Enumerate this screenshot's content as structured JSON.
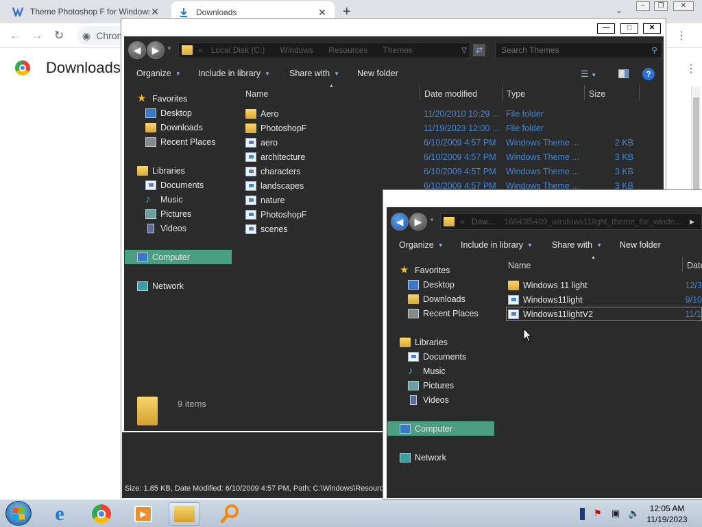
{
  "browser": {
    "tabs": [
      {
        "title": "Theme Photoshop F for Windows"
      },
      {
        "title": "Downloads"
      }
    ],
    "new_tab": "+",
    "omnibox_text": "Chrom",
    "page_title": "Downloads"
  },
  "explorer1": {
    "breadcrumb": [
      "Local Disk (C:)",
      "Windows",
      "Resources",
      "Themes"
    ],
    "search_placeholder": "Search Themes",
    "toolbar": {
      "organize": "Organize",
      "include": "Include in library",
      "share": "Share with",
      "new_folder": "New folder"
    },
    "columns": {
      "name": "Name",
      "date": "Date modified",
      "type": "Type",
      "size": "Size"
    },
    "files": [
      {
        "name": "Aero",
        "date": "11/20/2010 10:29 ...",
        "type": "File folder",
        "size": "",
        "icon": "folder-icon"
      },
      {
        "name": "PhotoshopF",
        "date": "11/19/2023 12:00 ...",
        "type": "File folder",
        "size": "",
        "icon": "folder-icon"
      },
      {
        "name": "aero",
        "date": "6/10/2009 4:57 PM",
        "type": "Windows Theme ...",
        "size": "2 KB",
        "icon": "theme-file-icon"
      },
      {
        "name": "architecture",
        "date": "6/10/2009 4:57 PM",
        "type": "Windows Theme ...",
        "size": "3 KB",
        "icon": "theme-file-icon"
      },
      {
        "name": "characters",
        "date": "6/10/2009 4:57 PM",
        "type": "Windows Theme ...",
        "size": "3 KB",
        "icon": "theme-file-icon"
      },
      {
        "name": "landscapes",
        "date": "6/10/2009 4:57 PM",
        "type": "Windows Theme ...",
        "size": "3 KB",
        "icon": "theme-file-icon"
      },
      {
        "name": "nature",
        "date": "",
        "type": "",
        "size": "",
        "icon": "theme-file-icon"
      },
      {
        "name": "PhotoshopF",
        "date": "",
        "type": "",
        "size": "",
        "icon": "theme-file-icon"
      },
      {
        "name": "scenes",
        "date": "",
        "type": "",
        "size": "",
        "icon": "theme-file-icon"
      }
    ],
    "status_count": "9 items",
    "details_bar": "Size: 1.85 KB, Date Modified: 6/10/2009 4:57 PM, Path: C:\\Windows\\Resource"
  },
  "nav": {
    "favorites": "Favorites",
    "desktop": "Desktop",
    "downloads": "Downloads",
    "recent": "Recent Places",
    "libraries": "Libraries",
    "documents": "Documents",
    "music": "Music",
    "pictures": "Pictures",
    "videos": "Videos",
    "computer": "Computer",
    "network": "Network"
  },
  "explorer2": {
    "breadcrumb": [
      "Dow...",
      "16843f5409_windows11light_theme_for_windo..."
    ],
    "toolbar": {
      "organize": "Organize",
      "include": "Include in library",
      "share": "Share with",
      "new_folder": "New folder"
    },
    "columns": {
      "name": "Name",
      "date": "Date"
    },
    "files": [
      {
        "name": "Windows 11 light",
        "date": "12/3",
        "icon": "folder-icon"
      },
      {
        "name": "Windows11light",
        "date": "9/10",
        "icon": "theme-file-icon"
      },
      {
        "name": "Windows11lightV2",
        "date": "11/1",
        "icon": "theme-file-icon"
      }
    ]
  },
  "clock": {
    "time": "12:05 AM",
    "date": "11/19/2023"
  },
  "colors": {
    "selection": "#4a9e82",
    "dim_text": "#3f86d8",
    "explorer_bg": "#2b2b2b"
  }
}
